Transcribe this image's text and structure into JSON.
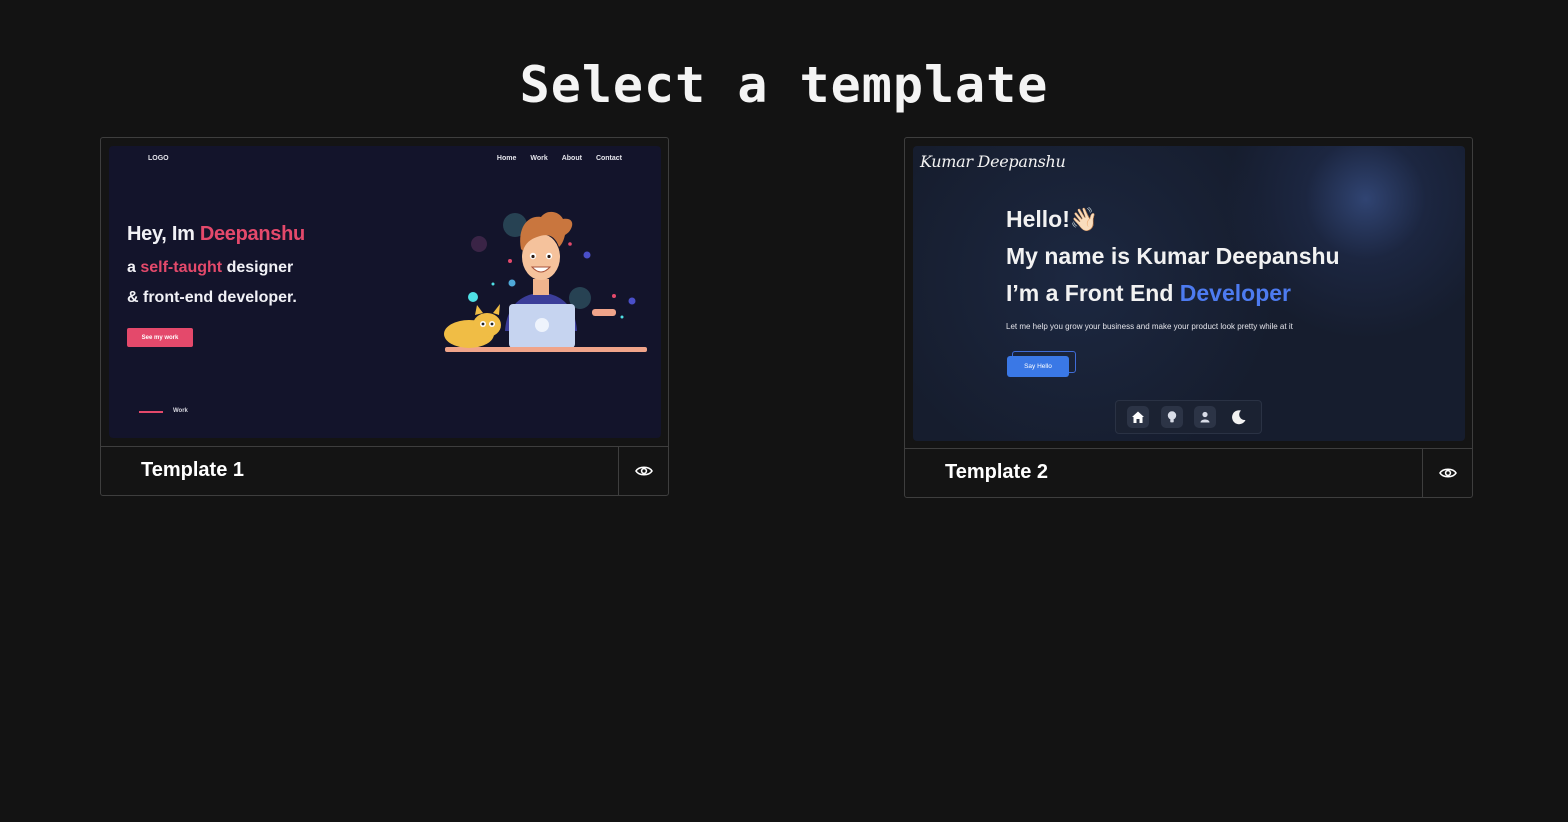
{
  "page": {
    "title": "Select a template"
  },
  "templates": [
    {
      "name": "Template 1",
      "preview": {
        "logo": "LOGO",
        "nav": [
          "Home",
          "Work",
          "About",
          "Contact"
        ],
        "headline_prefix": "Hey, Im ",
        "headline_highlight": "Deepanshu",
        "line2_prefix": "a ",
        "line2_highlight": "self-taught",
        "line2_suffix": " designer",
        "line3": "& front-end developer.",
        "cta": "See my work",
        "scroll_label": "Work",
        "accent_color": "#e4496b",
        "background_color": "#13142b"
      }
    },
    {
      "name": "Template 2",
      "preview": {
        "brand": "Kumar Deepanshu",
        "greeting": "Hello!",
        "greeting_emoji": "👋🏻",
        "line2": "My name is Kumar Deepanshu",
        "line3_prefix": "I’m a Front End ",
        "line3_highlight": "Developer",
        "lead": "Let me help you grow your business and make your product look pretty while at it",
        "cta": "Say Hello",
        "dock_icons": [
          "home-icon",
          "lightbulb-icon",
          "user-icon",
          "moon-icon"
        ],
        "accent_color": "#4d7bf0",
        "background_color": "#161d2e"
      }
    }
  ],
  "actions": {
    "preview_icon": "eye-icon"
  }
}
